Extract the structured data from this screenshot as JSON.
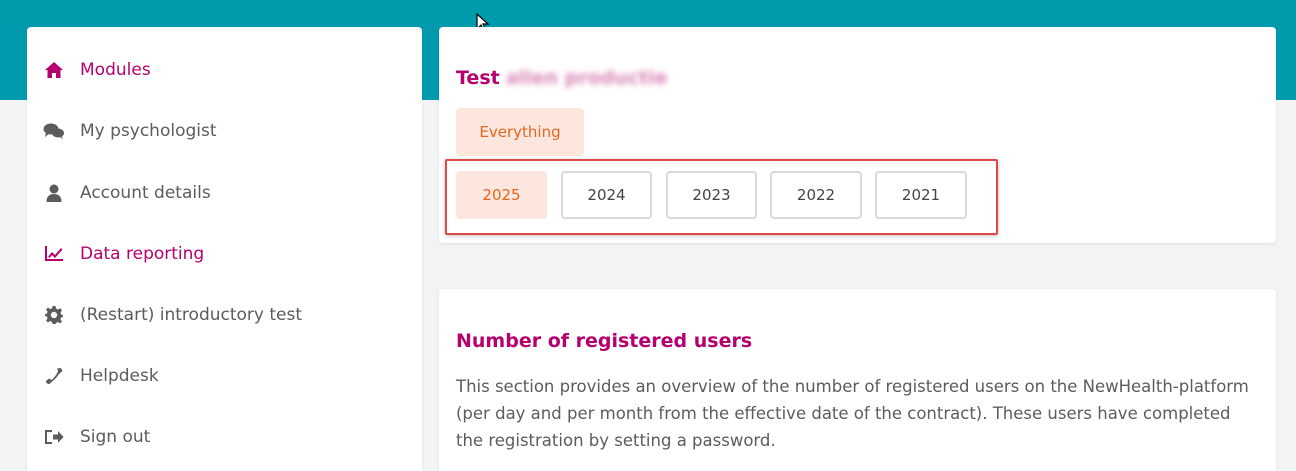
{
  "sidebar": {
    "items": [
      {
        "label": "Modules",
        "icon": "home-icon",
        "active": true
      },
      {
        "label": "My psychologist",
        "icon": "chat-icon",
        "active": false
      },
      {
        "label": "Account details",
        "icon": "user-icon",
        "active": false
      },
      {
        "label": "Data reporting",
        "icon": "chart-icon",
        "active": true
      },
      {
        "label": "(Restart) introductory test",
        "icon": "gear-icon",
        "active": false
      },
      {
        "label": "Helpdesk",
        "icon": "phone-icon",
        "active": false
      },
      {
        "label": "Sign out",
        "icon": "sign-out-icon",
        "active": false
      }
    ]
  },
  "main": {
    "test_title": "Test",
    "test_title_blurred": "allen productie",
    "filter_all": "Everything",
    "years": [
      "2025",
      "2024",
      "2023",
      "2022",
      "2021"
    ],
    "selected_year": "2025",
    "section": {
      "title": "Number of registered users",
      "description": "This section provides an overview of the number of registered users on the NewHealth-platform (per day and per month from the effective date of the contract). These users have completed the registration by setting a password."
    }
  },
  "colors": {
    "header_band": "#009aad",
    "accent": "#b5006e",
    "selected_bg": "#fde6dd",
    "selected_text": "#e2661f",
    "highlight_border": "#e04848"
  }
}
